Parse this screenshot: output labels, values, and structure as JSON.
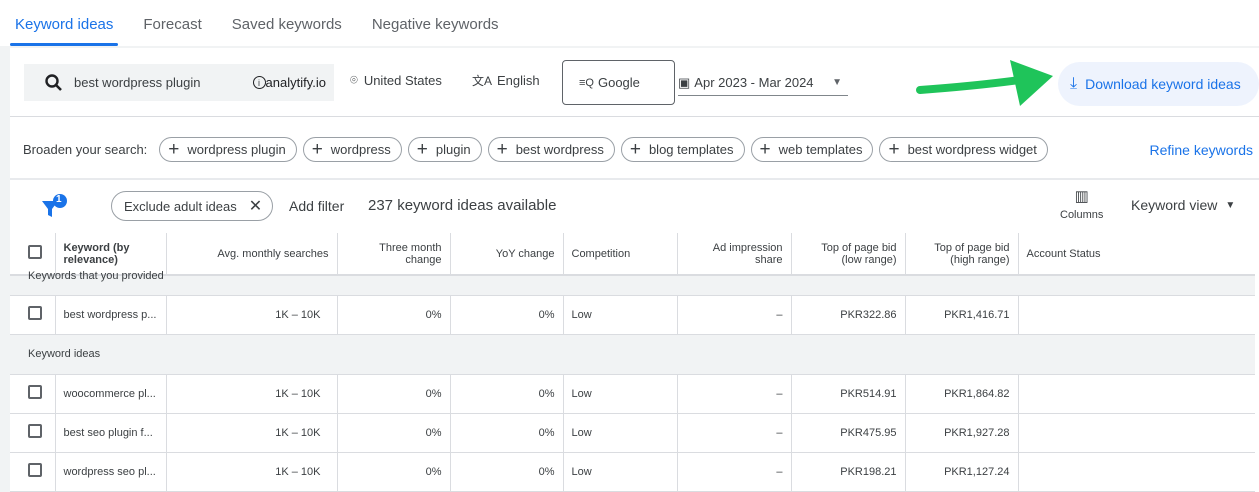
{
  "tabs": [
    "Keyword ideas",
    "Forecast",
    "Saved keywords",
    "Negative keywords"
  ],
  "search": {
    "query": "best wordpress plugin",
    "site": "analytify.io",
    "location": "United States",
    "language": "English",
    "network": "Google",
    "date_range": "Apr 2023 - Mar 2024",
    "download": "Download keyword ideas"
  },
  "broaden": {
    "label": "Broaden your search:",
    "chips": [
      "wordpress plugin",
      "wordpress",
      "plugin",
      "best wordpress",
      "blog templates",
      "web templates",
      "best wordpress widget"
    ],
    "refine": "Refine keywords"
  },
  "filters": {
    "badge": "1",
    "chip": "Exclude adult ideas",
    "add": "Add filter",
    "count": "237 keyword ideas available",
    "columns": "Columns",
    "view": "Keyword view"
  },
  "columns": [
    "Keyword (by relevance)",
    "Avg. monthly searches",
    "Three month change",
    "YoY change",
    "Competition",
    "Ad impression share",
    "Top of page bid (low range)",
    "Top of page bid (high range)",
    "Account Status"
  ],
  "groups": [
    "Keywords that you provided",
    "Keyword ideas"
  ],
  "provided": [
    {
      "kw": "best wordpress p...",
      "avg": "1K – 10K",
      "three": "0%",
      "yoy": "0%",
      "comp": "Low",
      "ad": "–",
      "low": "PKR322.86",
      "high": "PKR1,416.71"
    }
  ],
  "ideas": [
    {
      "kw": "woocommerce pl...",
      "avg": "1K – 10K",
      "three": "0%",
      "yoy": "0%",
      "comp": "Low",
      "ad": "–",
      "low": "PKR514.91",
      "high": "PKR1,864.82"
    },
    {
      "kw": "best seo plugin f...",
      "avg": "1K – 10K",
      "three": "0%",
      "yoy": "0%",
      "comp": "Low",
      "ad": "–",
      "low": "PKR475.95",
      "high": "PKR1,927.28"
    },
    {
      "kw": "wordpress seo pl...",
      "avg": "1K – 10K",
      "three": "0%",
      "yoy": "0%",
      "comp": "Low",
      "ad": "–",
      "low": "PKR198.21",
      "high": "PKR1,127.24"
    }
  ]
}
